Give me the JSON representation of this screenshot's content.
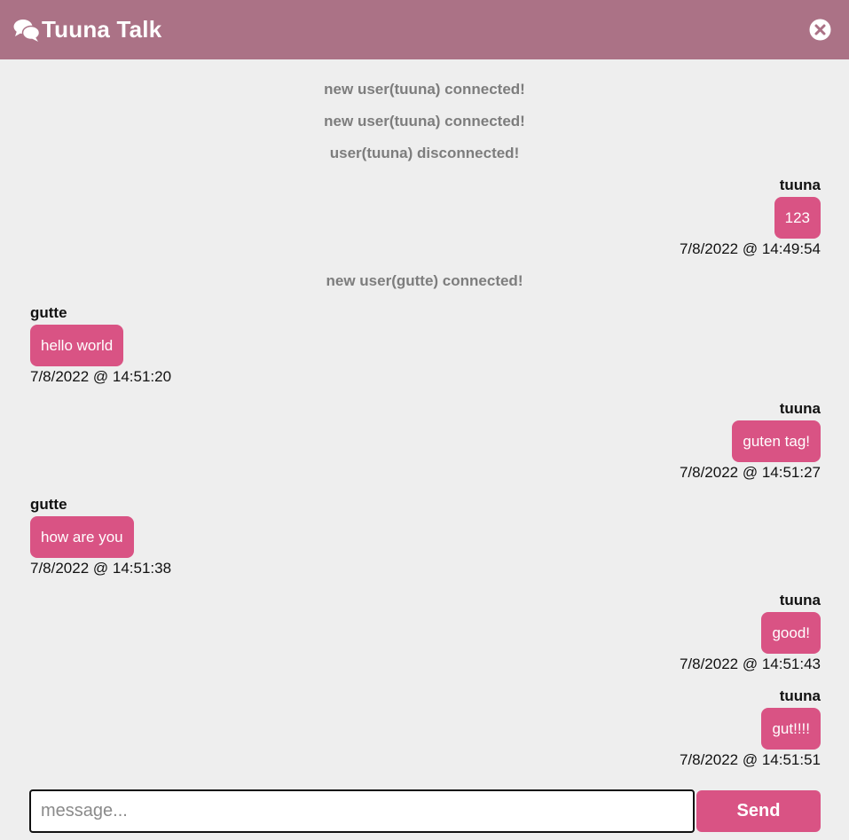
{
  "header": {
    "title": "Tuuna Talk",
    "icon": "chat-bubbles-icon",
    "close_icon": "close-circle-icon"
  },
  "colors": {
    "header_bg": "#ab7286",
    "bubble_bg": "#d95384",
    "page_bg": "#eeeeee",
    "system_text": "#7d7d7d"
  },
  "system_messages": [
    "new user(tuuna) connected!",
    "new user(tuuna) connected!",
    "user(tuuna) disconnected!",
    "new user(gutte) connected!"
  ],
  "messages": [
    {
      "author": "tuuna",
      "text": "123",
      "time": "7/8/2022 @ 14:49:54",
      "side": "right"
    },
    {
      "author": "gutte",
      "text": "hello world",
      "time": "7/8/2022 @ 14:51:20",
      "side": "left"
    },
    {
      "author": "tuuna",
      "text": "guten tag!",
      "time": "7/8/2022 @ 14:51:27",
      "side": "right"
    },
    {
      "author": "gutte",
      "text": "how are you",
      "time": "7/8/2022 @ 14:51:38",
      "side": "left"
    },
    {
      "author": "tuuna",
      "text": "good!",
      "time": "7/8/2022 @ 14:51:43",
      "side": "right"
    },
    {
      "author": "tuuna",
      "text": "gut!!!!",
      "time": "7/8/2022 @ 14:51:51",
      "side": "right"
    }
  ],
  "composer": {
    "placeholder": "message...",
    "value": "",
    "send_label": "Send"
  }
}
